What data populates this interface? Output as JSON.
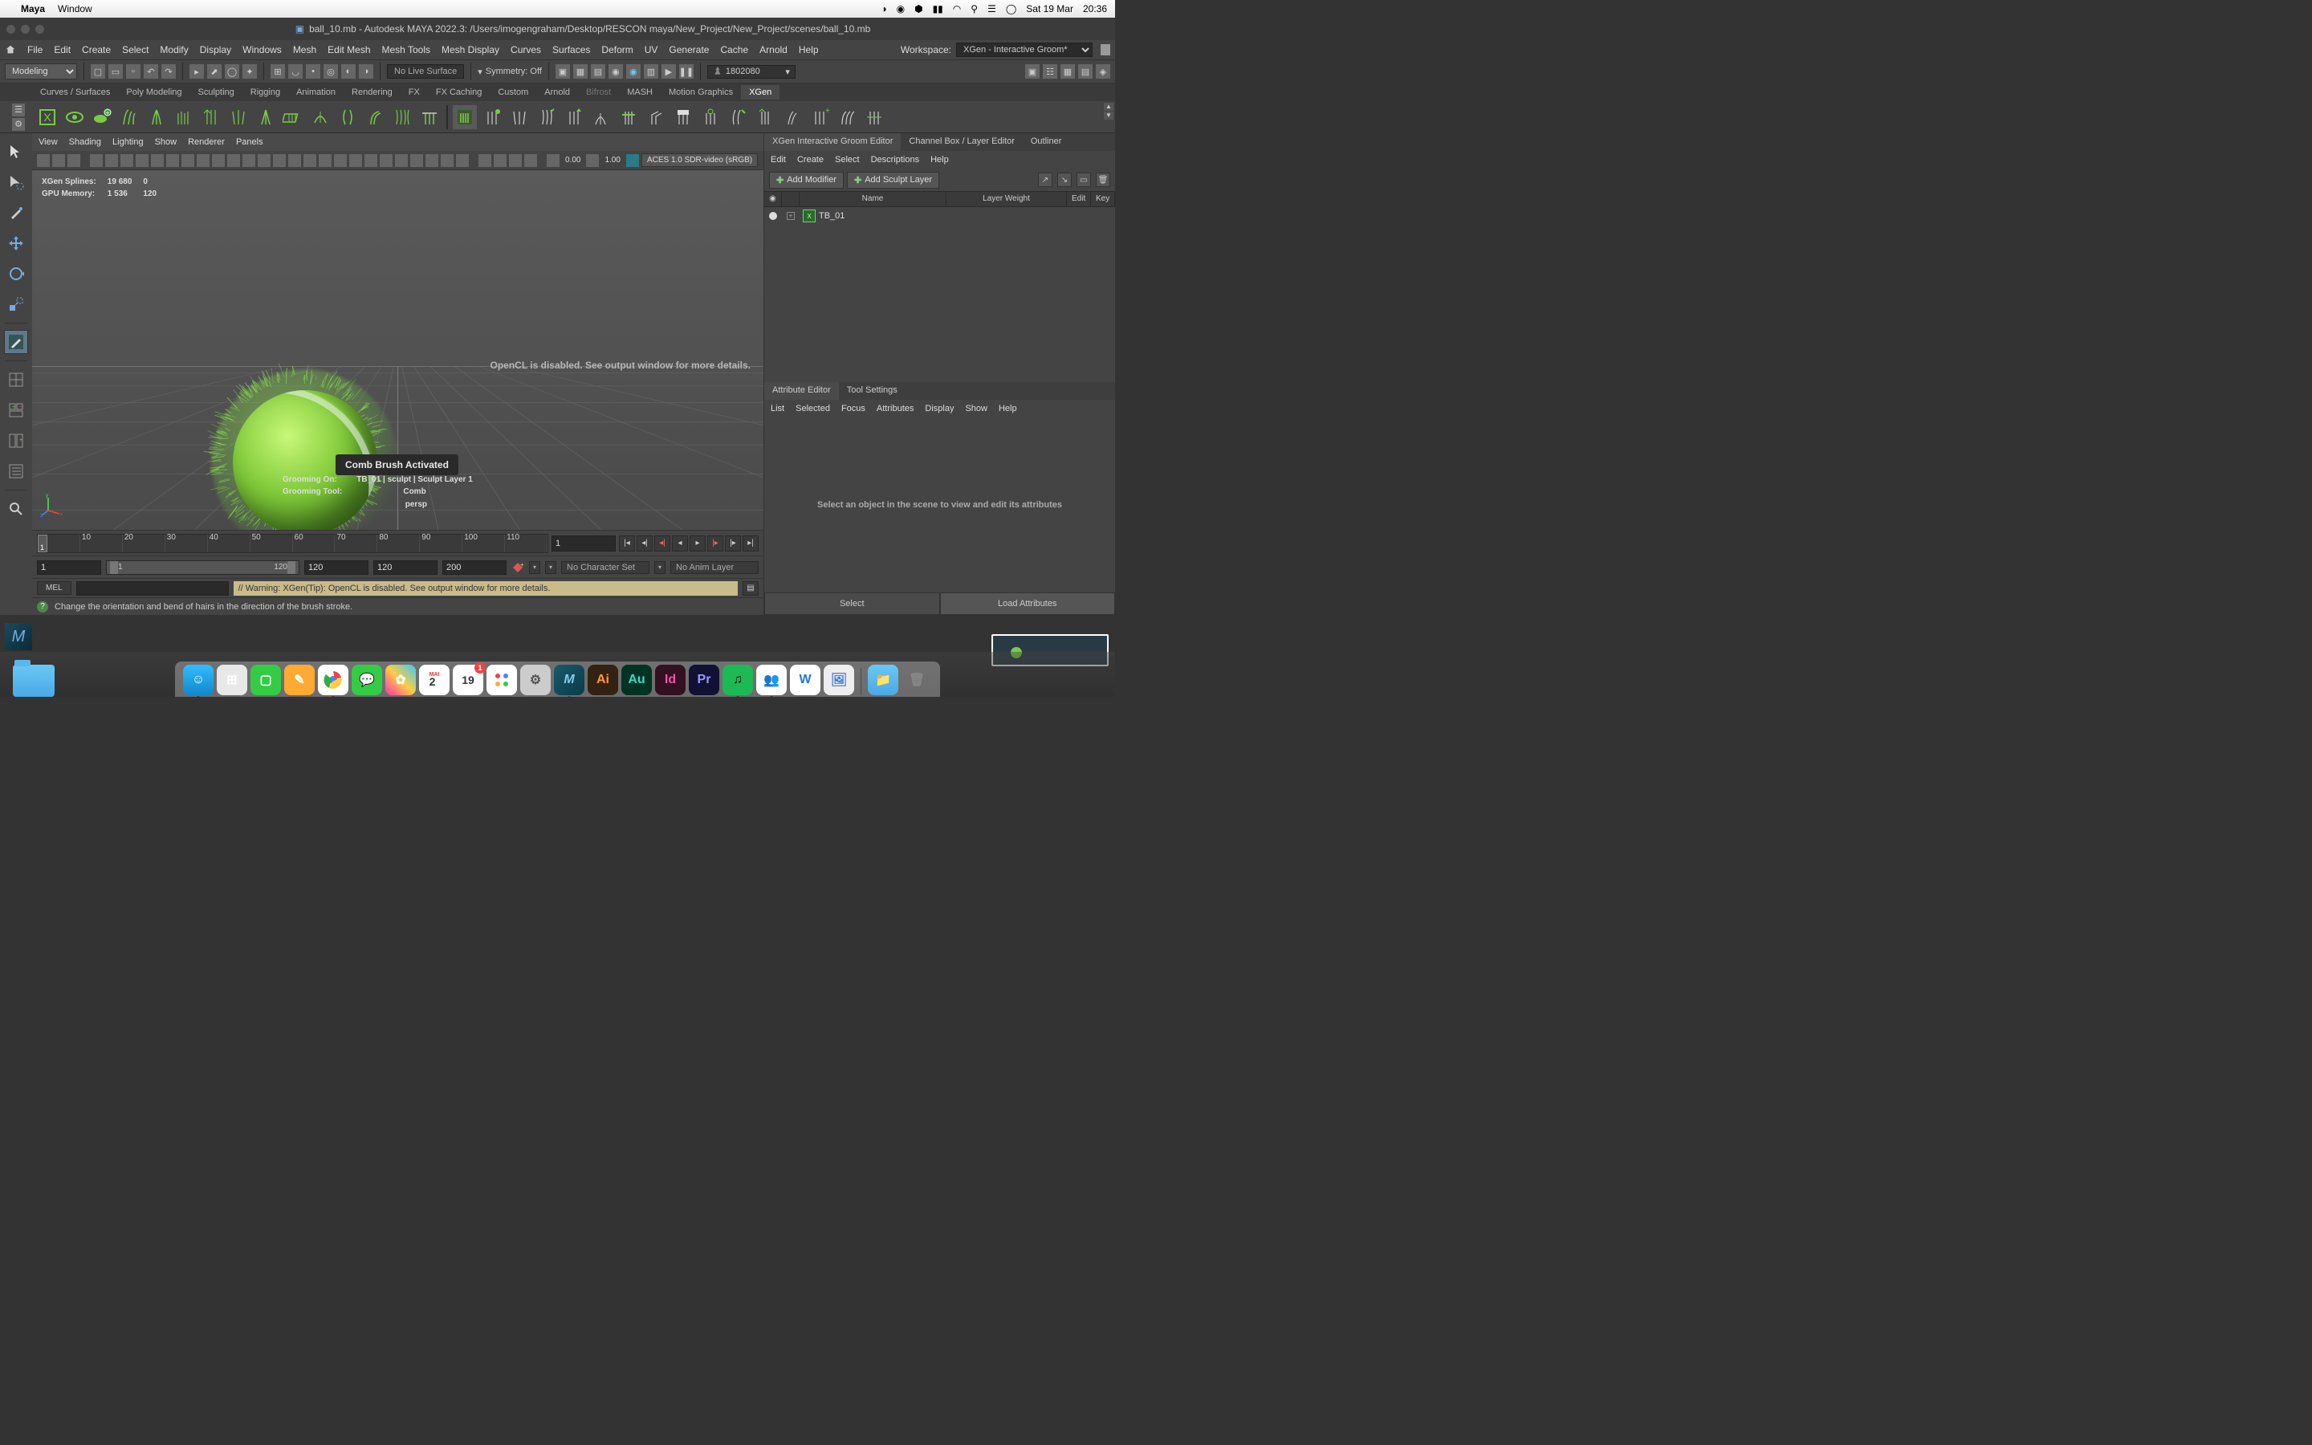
{
  "mac": {
    "app": "Maya",
    "menu": "Window",
    "date": "Sat 19 Mar",
    "time": "20:36"
  },
  "title": "ball_10.mb - Autodesk MAYA 2022.3: /Users/imogengraham/Desktop/RESCON maya/New_Project/New_Project/scenes/ball_10.mb",
  "menu": [
    "File",
    "Edit",
    "Create",
    "Select",
    "Modify",
    "Display",
    "Windows",
    "Mesh",
    "Edit Mesh",
    "Mesh Tools",
    "Mesh Display",
    "Curves",
    "Surfaces",
    "Deform",
    "UV",
    "Generate",
    "Cache",
    "Arnold",
    "Help"
  ],
  "workspace_label": "Workspace:",
  "workspace_value": "XGen - Interactive Groom*",
  "status": {
    "mode": "Modeling",
    "live_surface": "No Live Surface",
    "symmetry": "Symmetry: Off",
    "user": "1802080"
  },
  "shelves": [
    "Curves / Surfaces",
    "Poly Modeling",
    "Sculpting",
    "Rigging",
    "Animation",
    "Rendering",
    "FX",
    "FX Caching",
    "Custom",
    "Arnold",
    "Bifrost",
    "MASH",
    "Motion Graphics",
    "XGen"
  ],
  "shelves_active": "XGen",
  "panel_menu": [
    "View",
    "Shading",
    "Lighting",
    "Show",
    "Renderer",
    "Panels"
  ],
  "panel_toolbar": {
    "val1": "0.00",
    "val2": "1.00",
    "ocio": "ACES 1.0 SDR-video (sRGB)"
  },
  "stats": {
    "splines_label": "XGen Splines:",
    "splines_v1": "19 680",
    "splines_v2": "0",
    "gpu_label": "GPU Memory:",
    "gpu_v1": "1 536",
    "gpu_v2": "120"
  },
  "opencl": "OpenCL is disabled. See output window for more details.",
  "tooltip": "Comb Brush Activated",
  "groom": {
    "on_label": "Grooming On:",
    "on_value": "TB_01 | sculpt | Sculpt Layer 1",
    "tool_label": "Grooming Tool:",
    "tool_value": "Comb",
    "camera": "persp"
  },
  "xgen": {
    "tabs": [
      "XGen Interactive Groom Editor",
      "Channel Box / Layer Editor",
      "Outliner"
    ],
    "menu": [
      "Edit",
      "Create",
      "Select",
      "Descriptions",
      "Help"
    ],
    "add_modifier": "Add Modifier",
    "add_sculpt": "Add Sculpt Layer",
    "cols": {
      "name": "Name",
      "weight": "Layer Weight",
      "edit": "Edit",
      "key": "Key"
    },
    "row_name": "TB_01"
  },
  "ae": {
    "tabs": [
      "Attribute Editor",
      "Tool Settings"
    ],
    "menu": [
      "List",
      "Selected",
      "Focus",
      "Attributes",
      "Display",
      "Show",
      "Help"
    ],
    "msg": "Select an object in the scene to view and edit its attributes",
    "select": "Select",
    "load": "Load Attributes"
  },
  "time": {
    "ticks": [
      "10",
      "20",
      "30",
      "40",
      "50",
      "60",
      "70",
      "80",
      "90",
      "100",
      "110"
    ],
    "cursor_big": "1",
    "current": "1",
    "r_start": "1",
    "r_end": "120",
    "p_start": "1",
    "p_end": "120",
    "p_end2": "120",
    "fps": "200",
    "char": "No Character Set",
    "anim": "No Anim Layer"
  },
  "cmd": {
    "lang": "MEL",
    "warn": "// Warning: XGen(Tip):  OpenCL is disabled. See output window for more details."
  },
  "help": "Change the orientation and bend of hairs in the direction of the brush stroke.",
  "dock": [
    "Finder",
    "Launchpad",
    "FaceTime",
    "Notes",
    "Chrome",
    "Messages",
    "Photos",
    "ControlCenter",
    "Calendar",
    "Reminders",
    "SysPref",
    "Maya",
    "Ai",
    "Au",
    "Id",
    "Pr",
    "Spotify",
    "Teams",
    "Word",
    "Preview"
  ]
}
